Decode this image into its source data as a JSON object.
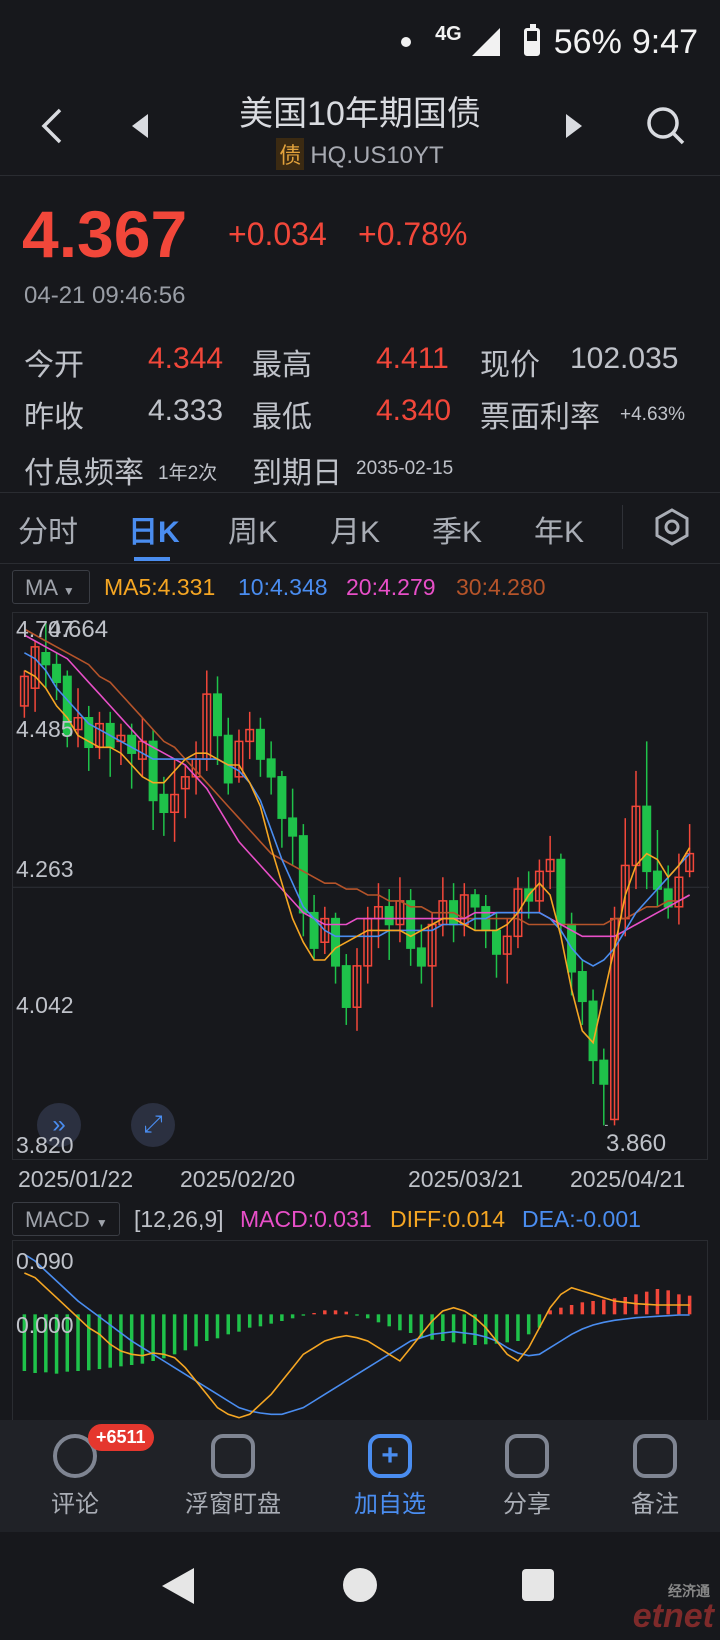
{
  "status_bar": {
    "network": "4G",
    "battery": "56%",
    "time": "9:47"
  },
  "header": {
    "title": "美国10年期国债",
    "bond_tag": "债",
    "code": "HQ.US10YT",
    "back_icon": "chevron-left-icon",
    "prev_icon": "triangle-left-icon",
    "next_icon": "triangle-right-icon",
    "search_icon": "search-icon"
  },
  "quote": {
    "price": "4.367",
    "change": "+0.034",
    "change_pct": "+0.78%",
    "timestamp": "04-21 09:46:56",
    "open_label": "今开",
    "open": "4.344",
    "high_label": "最高",
    "high": "4.411",
    "current_price_label": "现价",
    "current_price": "102.035",
    "prev_close_label": "昨收",
    "prev_close": "4.333",
    "low_label": "最低",
    "low": "4.340",
    "coupon_label": "票面利率",
    "coupon": "+4.63%",
    "freq_label": "付息频率",
    "freq": "1年2次",
    "maturity_label": "到期日",
    "maturity": "2035-02-15"
  },
  "tabs": [
    "分时",
    "日K",
    "周K",
    "月K",
    "季K",
    "年K"
  ],
  "active_tab": 1,
  "ma": {
    "selector": "MA",
    "ma5": "MA5:4.331",
    "ma10": "10:4.348",
    "ma20": "20:4.279",
    "ma30": "30:4.280",
    "colors": {
      "ma5": "#f5a623",
      "ma10": "#4a8df0",
      "ma20": "#e84fc8",
      "ma30": "#b5542a"
    }
  },
  "macd": {
    "selector": "MACD",
    "params": "[12,26,9]",
    "macd": "MACD:0.031",
    "diff": "DIFF:0.014",
    "dea": "DEA:-0.001",
    "y_labels": [
      "0.090",
      "0.000"
    ]
  },
  "chart_data": {
    "type": "candlestick",
    "y_ticks": [
      "4.707",
      "4.485",
      "4.263",
      "4.042",
      "3.820"
    ],
    "ylim": [
      3.82,
      4.707
    ],
    "x_ticks": [
      "2025/01/22",
      "2025/02/20",
      "2025/03/21",
      "2025/04/21"
    ],
    "max_label": "4.664",
    "min_label": "3.860",
    "up_color": "#f2473a",
    "down_color": "#1fc24a",
    "candles": [
      [
        4.57,
        4.62,
        4.55,
        4.63
      ],
      [
        4.6,
        4.67,
        4.56,
        4.68
      ],
      [
        4.66,
        4.64,
        4.6,
        4.71
      ],
      [
        4.64,
        4.61,
        4.58,
        4.66
      ],
      [
        4.62,
        4.52,
        4.5,
        4.63
      ],
      [
        4.53,
        4.55,
        4.5,
        4.6
      ],
      [
        4.55,
        4.5,
        4.46,
        4.57
      ],
      [
        4.5,
        4.54,
        4.48,
        4.56
      ],
      [
        4.54,
        4.5,
        4.45,
        4.56
      ],
      [
        4.51,
        4.52,
        4.47,
        4.54
      ],
      [
        4.52,
        4.49,
        4.43,
        4.54
      ],
      [
        4.48,
        4.51,
        4.45,
        4.55
      ],
      [
        4.51,
        4.41,
        4.36,
        4.53
      ],
      [
        4.42,
        4.39,
        4.35,
        4.45
      ],
      [
        4.39,
        4.42,
        4.34,
        4.48
      ],
      [
        4.43,
        4.45,
        4.38,
        4.47
      ],
      [
        4.45,
        4.48,
        4.42,
        4.51
      ],
      [
        4.48,
        4.59,
        4.46,
        4.63
      ],
      [
        4.59,
        4.52,
        4.47,
        4.62
      ],
      [
        4.52,
        4.44,
        4.42,
        4.55
      ],
      [
        4.45,
        4.51,
        4.44,
        4.53
      ],
      [
        4.51,
        4.53,
        4.48,
        4.56
      ],
      [
        4.53,
        4.48,
        4.45,
        4.55
      ],
      [
        4.48,
        4.45,
        4.42,
        4.51
      ],
      [
        4.45,
        4.38,
        4.33,
        4.46
      ],
      [
        4.38,
        4.35,
        4.3,
        4.43
      ],
      [
        4.35,
        4.22,
        4.18,
        4.37
      ],
      [
        4.22,
        4.16,
        4.14,
        4.25
      ],
      [
        4.17,
        4.21,
        4.15,
        4.23
      ],
      [
        4.21,
        4.13,
        4.1,
        4.22
      ],
      [
        4.13,
        4.06,
        4.03,
        4.15
      ],
      [
        4.06,
        4.13,
        4.02,
        4.16
      ],
      [
        4.13,
        4.21,
        4.1,
        4.23
      ],
      [
        4.21,
        4.23,
        4.16,
        4.27
      ],
      [
        4.23,
        4.2,
        4.14,
        4.26
      ],
      [
        4.2,
        4.24,
        4.17,
        4.28
      ],
      [
        4.24,
        4.16,
        4.13,
        4.26
      ],
      [
        4.16,
        4.13,
        4.1,
        4.2
      ],
      [
        4.13,
        4.2,
        4.06,
        4.22
      ],
      [
        4.2,
        4.24,
        4.18,
        4.28
      ],
      [
        4.24,
        4.2,
        4.17,
        4.27
      ],
      [
        4.2,
        4.25,
        4.18,
        4.27
      ],
      [
        4.25,
        4.23,
        4.19,
        4.26
      ],
      [
        4.23,
        4.19,
        4.16,
        4.25
      ],
      [
        4.19,
        4.15,
        4.11,
        4.22
      ],
      [
        4.15,
        4.18,
        4.1,
        4.21
      ],
      [
        4.18,
        4.26,
        4.16,
        4.28
      ],
      [
        4.26,
        4.24,
        4.21,
        4.29
      ],
      [
        4.24,
        4.29,
        4.22,
        4.31
      ],
      [
        4.29,
        4.31,
        4.26,
        4.35
      ],
      [
        4.31,
        4.2,
        4.18,
        4.32
      ],
      [
        4.2,
        4.12,
        4.08,
        4.22
      ],
      [
        4.12,
        4.07,
        4.03,
        4.14
      ],
      [
        4.07,
        3.97,
        3.93,
        4.09
      ],
      [
        3.97,
        3.93,
        3.86,
        3.99
      ],
      [
        3.87,
        4.21,
        3.86,
        4.23
      ],
      [
        4.21,
        4.3,
        4.18,
        4.38
      ],
      [
        4.3,
        4.4,
        4.26,
        4.46
      ],
      [
        4.4,
        4.29,
        4.26,
        4.51
      ],
      [
        4.29,
        4.26,
        4.23,
        4.36
      ],
      [
        4.26,
        4.23,
        4.21,
        4.3
      ],
      [
        4.23,
        4.28,
        4.2,
        4.32
      ],
      [
        4.29,
        4.32,
        4.28,
        4.37
      ]
    ],
    "ma5": [
      4.63,
      4.62,
      4.6,
      4.57,
      4.55,
      4.52,
      4.51,
      4.5,
      4.5,
      4.49,
      4.47,
      4.45,
      4.44,
      4.44,
      4.46,
      4.48,
      4.49,
      4.49,
      4.48,
      4.47,
      4.47,
      4.44,
      4.4,
      4.33,
      4.27,
      4.21,
      4.17,
      4.14,
      4.14,
      4.16,
      4.17,
      4.18,
      4.19,
      4.19,
      4.19,
      4.19,
      4.18,
      4.19,
      4.2,
      4.21,
      4.21,
      4.2,
      4.19,
      4.19,
      4.19,
      4.2,
      4.22,
      4.25,
      4.27,
      4.25,
      4.18,
      4.09,
      4.02,
      4.0,
      4.08,
      4.16,
      4.25,
      4.3,
      4.32,
      4.31,
      4.28,
      4.3,
      4.33
    ],
    "ma10": [
      4.66,
      4.65,
      4.63,
      4.6,
      4.58,
      4.56,
      4.54,
      4.53,
      4.52,
      4.51,
      4.5,
      4.49,
      4.48,
      4.48,
      4.48,
      4.48,
      4.48,
      4.48,
      4.48,
      4.47,
      4.46,
      4.44,
      4.41,
      4.36,
      4.31,
      4.27,
      4.23,
      4.21,
      4.19,
      4.18,
      4.18,
      4.18,
      4.18,
      4.18,
      4.19,
      4.19,
      4.19,
      4.19,
      4.19,
      4.2,
      4.2,
      4.2,
      4.21,
      4.21,
      4.22,
      4.22,
      4.22,
      4.22,
      4.22,
      4.21,
      4.19,
      4.16,
      4.14,
      4.13,
      4.14,
      4.16,
      4.19,
      4.22,
      4.24,
      4.26,
      4.28,
      4.3,
      4.32
    ],
    "ma20": [
      4.69,
      4.68,
      4.67,
      4.66,
      4.65,
      4.63,
      4.61,
      4.59,
      4.57,
      4.55,
      4.53,
      4.51,
      4.5,
      4.49,
      4.48,
      4.47,
      4.45,
      4.43,
      4.4,
      4.37,
      4.34,
      4.32,
      4.3,
      4.28,
      4.26,
      4.24,
      4.22,
      4.21,
      4.2,
      4.2,
      4.2,
      4.21,
      4.21,
      4.21,
      4.21,
      4.21,
      4.21,
      4.21,
      4.21,
      4.21,
      4.21,
      4.21,
      4.22,
      4.22,
      4.22,
      4.22,
      4.22,
      4.22,
      4.22,
      4.21,
      4.2,
      4.19,
      4.18,
      4.18,
      4.18,
      4.18,
      4.19,
      4.2,
      4.21,
      4.22,
      4.23,
      4.24,
      4.25
    ],
    "ma30": [
      4.7,
      4.69,
      4.68,
      4.67,
      4.66,
      4.65,
      4.64,
      4.62,
      4.61,
      4.59,
      4.57,
      4.55,
      4.53,
      4.51,
      4.5,
      4.48,
      4.46,
      4.44,
      4.42,
      4.4,
      4.38,
      4.36,
      4.34,
      4.32,
      4.31,
      4.3,
      4.29,
      4.28,
      4.27,
      4.27,
      4.26,
      4.26,
      4.25,
      4.25,
      4.24,
      4.24,
      4.23,
      4.23,
      4.22,
      4.22,
      4.22,
      4.21,
      4.21,
      4.21,
      4.21,
      4.21,
      4.21,
      4.2,
      4.2,
      4.2,
      4.2,
      4.2,
      4.2,
      4.2,
      4.2,
      4.21,
      4.21,
      4.22,
      4.23,
      4.23,
      4.24,
      4.24,
      4.25
    ],
    "macd_hist": [
      -0.085,
      -0.088,
      -0.087,
      -0.089,
      -0.086,
      -0.085,
      -0.084,
      -0.082,
      -0.08,
      -0.078,
      -0.076,
      -0.074,
      -0.07,
      -0.066,
      -0.06,
      -0.054,
      -0.048,
      -0.04,
      -0.036,
      -0.03,
      -0.026,
      -0.02,
      -0.018,
      -0.014,
      -0.01,
      -0.006,
      -0.002,
      0.002,
      0.006,
      0.006,
      0.004,
      -0.002,
      -0.006,
      -0.012,
      -0.018,
      -0.024,
      -0.028,
      -0.034,
      -0.038,
      -0.04,
      -0.042,
      -0.044,
      -0.046,
      -0.045,
      -0.044,
      -0.042,
      -0.04,
      -0.03,
      -0.02,
      0.006,
      0.01,
      0.014,
      0.018,
      0.02,
      0.022,
      0.024,
      0.026,
      0.03,
      0.034,
      0.038,
      0.036,
      0.03,
      0.028
    ],
    "macd_diff": [
      0.062,
      0.055,
      0.04,
      0.025,
      0.01,
      -0.005,
      -0.02,
      -0.03,
      -0.045,
      -0.055,
      -0.06,
      -0.062,
      -0.058,
      -0.06,
      -0.065,
      -0.08,
      -0.1,
      -0.12,
      -0.14,
      -0.15,
      -0.155,
      -0.15,
      -0.135,
      -0.12,
      -0.1,
      -0.08,
      -0.06,
      -0.05,
      -0.04,
      -0.035,
      -0.032,
      -0.035,
      -0.04,
      -0.05,
      -0.06,
      -0.07,
      -0.05,
      -0.03,
      -0.01,
      0.005,
      0.01,
      0.005,
      -0.005,
      -0.02,
      -0.04,
      -0.06,
      -0.07,
      -0.05,
      -0.02,
      0.01,
      0.03,
      0.04,
      0.035,
      0.03,
      0.025,
      0.02,
      0.018,
      0.016,
      0.015,
      0.014,
      0.014,
      0.014,
      0.014
    ],
    "macd_dea": [
      0.09,
      0.08,
      0.065,
      0.05,
      0.035,
      0.02,
      0.008,
      -0.004,
      -0.016,
      -0.028,
      -0.04,
      -0.05,
      -0.06,
      -0.07,
      -0.08,
      -0.09,
      -0.1,
      -0.11,
      -0.12,
      -0.13,
      -0.14,
      -0.145,
      -0.148,
      -0.15,
      -0.15,
      -0.145,
      -0.14,
      -0.13,
      -0.12,
      -0.11,
      -0.1,
      -0.09,
      -0.08,
      -0.07,
      -0.06,
      -0.05,
      -0.04,
      -0.035,
      -0.03,
      -0.028,
      -0.026,
      -0.028,
      -0.03,
      -0.034,
      -0.04,
      -0.05,
      -0.058,
      -0.062,
      -0.06,
      -0.05,
      -0.04,
      -0.03,
      -0.022,
      -0.016,
      -0.012,
      -0.009,
      -0.007,
      -0.005,
      -0.004,
      -0.003,
      -0.002,
      -0.001,
      -0.001
    ]
  },
  "bottom_nav": [
    {
      "label": "评论",
      "icon": "comment-icon",
      "badge": "+6511"
    },
    {
      "label": "浮窗盯盘",
      "icon": "floating-window-icon"
    },
    {
      "label": "加自选",
      "icon": "add-watchlist-icon"
    },
    {
      "label": "分享",
      "icon": "share-icon"
    },
    {
      "label": "备注",
      "icon": "note-icon"
    }
  ],
  "watermark": {
    "cn": "经济通",
    "en": "etnet"
  }
}
